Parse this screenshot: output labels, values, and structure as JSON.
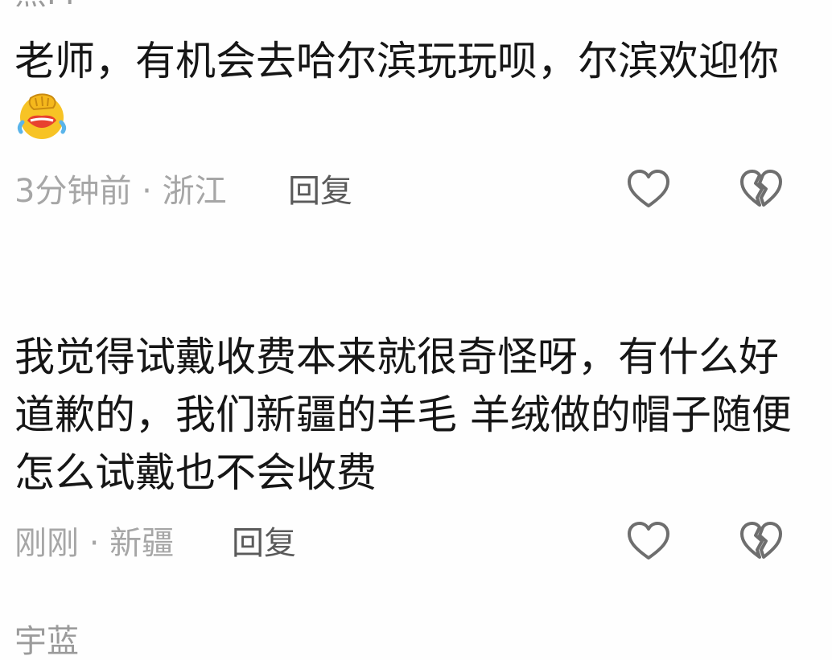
{
  "prev_user": {
    "name": "熊M"
  },
  "comments": [
    {
      "text": "老师，有机会去哈尔滨玩玩呗，尔滨欢迎你",
      "emoji": "face-palm-crying-emoji",
      "meta": "3分钟前 · 浙江",
      "reply_label": "回复",
      "like_icon": "heart-outline-icon",
      "dislike_icon": "broken-heart-icon"
    },
    {
      "text": "我觉得试戴收费本来就很奇怪呀，有什么好道歉的，我们新疆的羊毛 羊绒做的帽子随便怎么试戴也不会收费",
      "meta": "刚刚 · 新疆",
      "reply_label": "回复",
      "like_icon": "heart-outline-icon",
      "dislike_icon": "broken-heart-icon"
    }
  ],
  "next_user": {
    "name": "宇蓝"
  },
  "colors": {
    "text": "#161616",
    "meta": "#a6a6a6",
    "reply": "#5a5a5a",
    "icon": "#6e6e6e",
    "emoji_yellow": "#f7c325",
    "emoji_mouth": "#e8412f",
    "emoji_tears": "#5ab4ea"
  }
}
